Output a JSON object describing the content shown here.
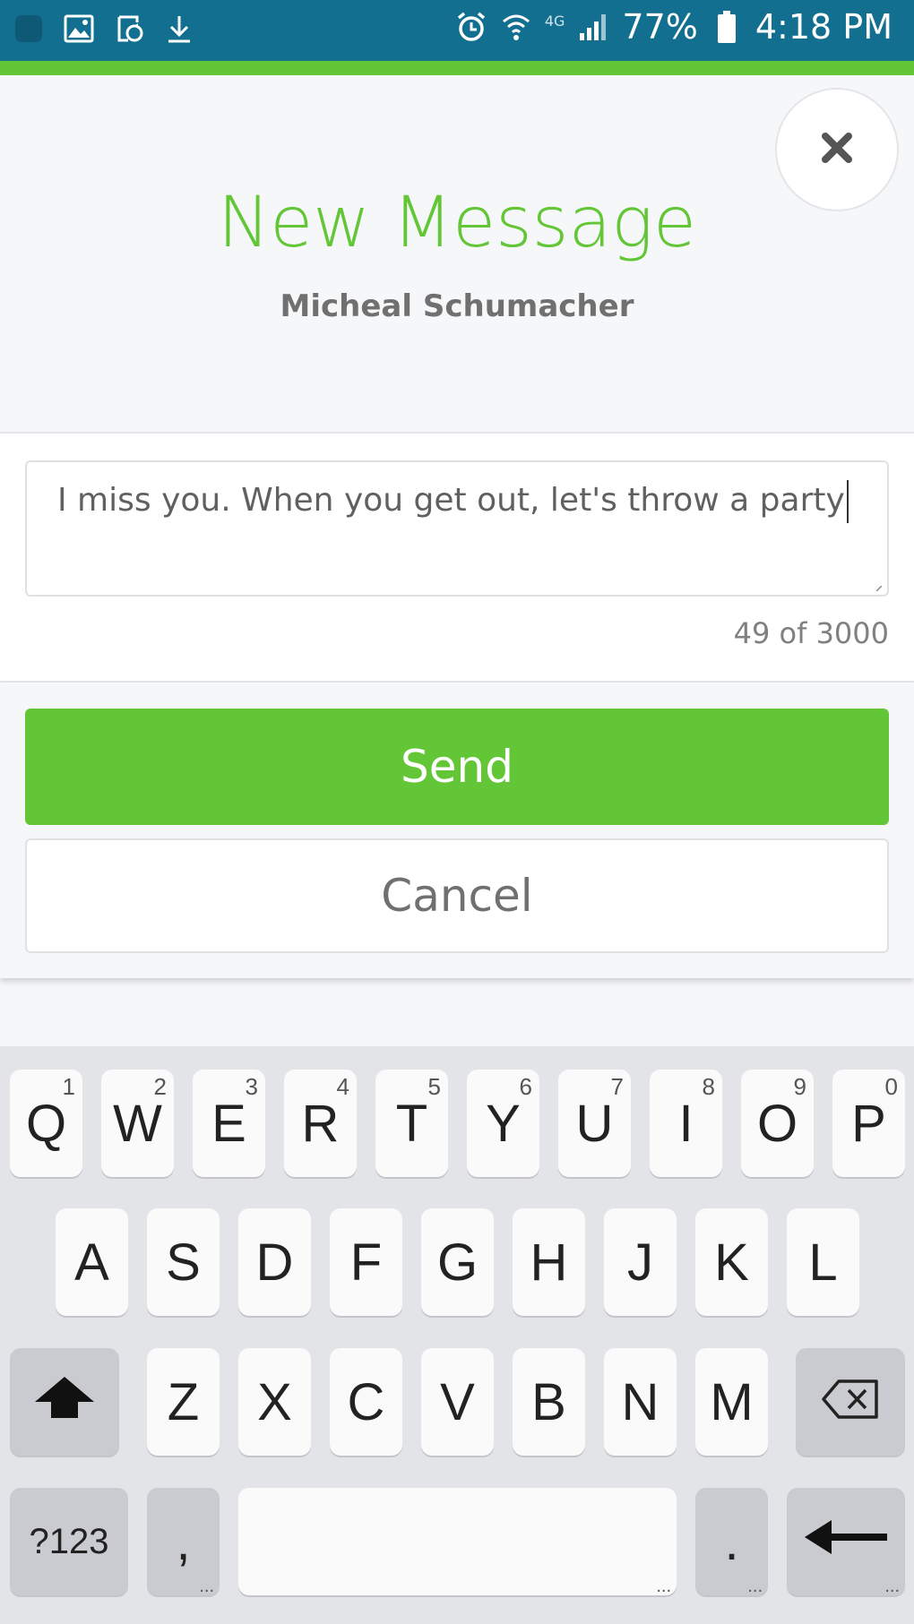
{
  "status_bar": {
    "battery_percent": "77%",
    "time": "4:18 PM",
    "network": "4G",
    "left_icons": [
      "app-icon",
      "image-icon",
      "sync-icon",
      "download-icon"
    ],
    "right_icons": [
      "alarm-icon",
      "wifi-icon",
      "signal-icon",
      "battery-icon"
    ]
  },
  "header": {
    "title": "New Message",
    "recipient": "Micheal Schumacher",
    "close_icon": "close-icon"
  },
  "message": {
    "text": "I miss you. When you get out, let's throw a party",
    "counter": "49 of 3000"
  },
  "actions": {
    "send_label": "Send",
    "cancel_label": "Cancel"
  },
  "keyboard": {
    "row1": [
      {
        "key": "Q",
        "hint": "1"
      },
      {
        "key": "W",
        "hint": "2"
      },
      {
        "key": "E",
        "hint": "3"
      },
      {
        "key": "R",
        "hint": "4"
      },
      {
        "key": "T",
        "hint": "5"
      },
      {
        "key": "Y",
        "hint": "6"
      },
      {
        "key": "U",
        "hint": "7"
      },
      {
        "key": "I",
        "hint": "8"
      },
      {
        "key": "O",
        "hint": "9"
      },
      {
        "key": "P",
        "hint": "0"
      }
    ],
    "row2": [
      "A",
      "S",
      "D",
      "F",
      "G",
      "H",
      "J",
      "K",
      "L"
    ],
    "row3": [
      "Z",
      "X",
      "C",
      "V",
      "B",
      "N",
      "M"
    ],
    "symbols_label": "?123",
    "comma": ",",
    "period": ".",
    "ellipsis": "..."
  },
  "colors": {
    "status_bar": "#126f90",
    "accent_green": "#62c636"
  }
}
